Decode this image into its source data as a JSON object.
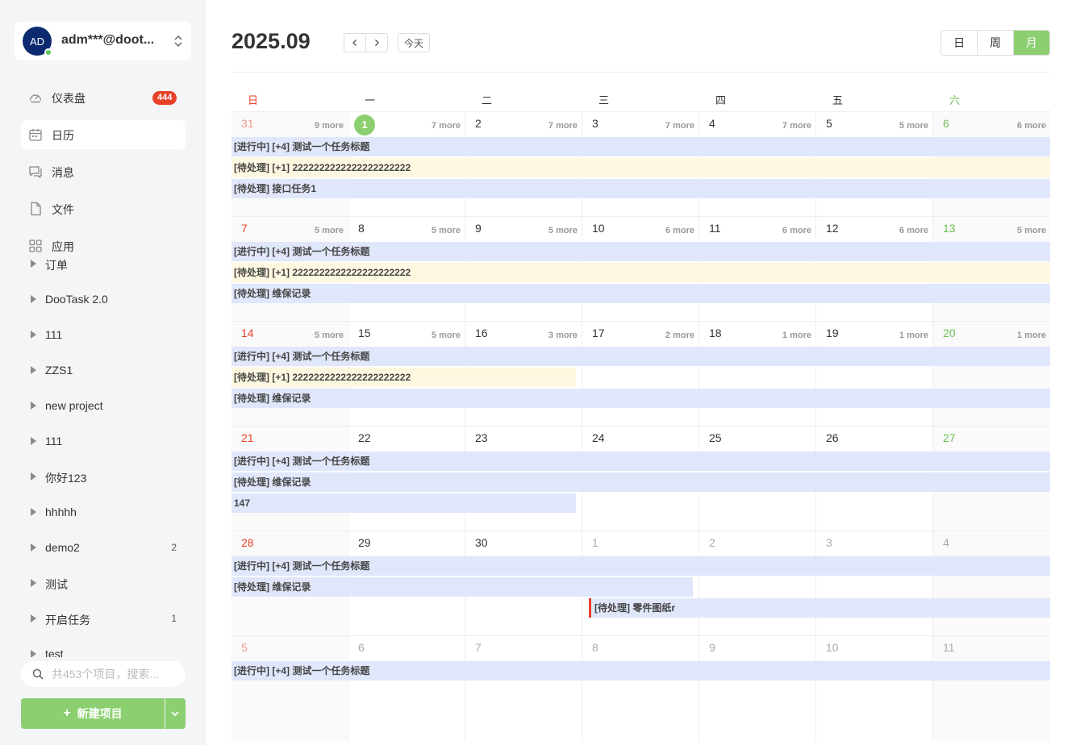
{
  "account": {
    "avatar_text": "AD",
    "name": "adm***@doot..."
  },
  "nav": [
    {
      "label": "仪表盘",
      "icon": "dashboard-icon",
      "badge": "444",
      "active": false
    },
    {
      "label": "日历",
      "icon": "calendar-icon",
      "badge": "",
      "active": true
    },
    {
      "label": "消息",
      "icon": "message-icon",
      "badge": "",
      "active": false
    },
    {
      "label": "文件",
      "icon": "file-icon",
      "badge": "",
      "active": false
    },
    {
      "label": "应用",
      "icon": "apps-icon",
      "badge": "",
      "active": false
    }
  ],
  "projects": [
    {
      "name": "订单",
      "count": ""
    },
    {
      "name": "DooTask 2.0",
      "count": ""
    },
    {
      "name": "111",
      "count": ""
    },
    {
      "name": "ZZS1",
      "count": ""
    },
    {
      "name": "new project",
      "count": ""
    },
    {
      "name": "111",
      "count": ""
    },
    {
      "name": "你好123",
      "count": ""
    },
    {
      "name": "hhhhh",
      "count": ""
    },
    {
      "name": "demo2",
      "count": "2"
    },
    {
      "name": "测试",
      "count": ""
    },
    {
      "name": "开启任务",
      "count": "1"
    },
    {
      "name": "test",
      "count": ""
    }
  ],
  "search": {
    "placeholder": "共453个项目，搜索..."
  },
  "new_project_label": "新建项目",
  "calendar": {
    "title": "2025.09",
    "today_label": "今天",
    "views": [
      {
        "label": "日",
        "active": false
      },
      {
        "label": "周",
        "active": false
      },
      {
        "label": "月",
        "active": true
      }
    ],
    "weekdays": [
      "日",
      "一",
      "二",
      "三",
      "四",
      "五",
      "六"
    ],
    "weeks": [
      {
        "days": [
          {
            "num": "31",
            "other": true,
            "more": "9 more"
          },
          {
            "num": "1",
            "other": false,
            "today": true,
            "more": "7 more"
          },
          {
            "num": "2",
            "other": false,
            "more": "7 more"
          },
          {
            "num": "3",
            "other": false,
            "more": "7 more"
          },
          {
            "num": "4",
            "other": false,
            "more": "7 more"
          },
          {
            "num": "5",
            "other": false,
            "more": "5 more"
          },
          {
            "num": "6",
            "other": false,
            "more": "6 more"
          }
        ],
        "events": [
          {
            "text": "[进行中] [+4] 测试一个任务标题",
            "row": 0,
            "start": 0,
            "end": 7,
            "color": "blue"
          },
          {
            "text": "[待处理] [+1] 2222222222222222222222",
            "row": 1,
            "start": 0,
            "end": 7,
            "color": "yellow"
          },
          {
            "text": "[待处理] 接口任务1",
            "row": 2,
            "start": 0,
            "end": 7,
            "color": "blue"
          }
        ]
      },
      {
        "days": [
          {
            "num": "7",
            "other": false,
            "more": "5 more"
          },
          {
            "num": "8",
            "other": false,
            "more": "5 more"
          },
          {
            "num": "9",
            "other": false,
            "more": "5 more"
          },
          {
            "num": "10",
            "other": false,
            "more": "6 more"
          },
          {
            "num": "11",
            "other": false,
            "more": "6 more"
          },
          {
            "num": "12",
            "other": false,
            "more": "6 more"
          },
          {
            "num": "13",
            "other": false,
            "more": "5 more"
          }
        ],
        "events": [
          {
            "text": "[进行中] [+4] 测试一个任务标题",
            "row": 0,
            "start": 0,
            "end": 7,
            "color": "blue"
          },
          {
            "text": "[待处理] [+1] 2222222222222222222222",
            "row": 1,
            "start": 0,
            "end": 7,
            "color": "yellow"
          },
          {
            "text": "[待处理] 维保记录",
            "row": 2,
            "start": 0,
            "end": 7,
            "color": "blue"
          }
        ]
      },
      {
        "days": [
          {
            "num": "14",
            "other": false,
            "more": "5 more"
          },
          {
            "num": "15",
            "other": false,
            "more": "5 more"
          },
          {
            "num": "16",
            "other": false,
            "more": "3 more"
          },
          {
            "num": "17",
            "other": false,
            "more": "2 more"
          },
          {
            "num": "18",
            "other": false,
            "more": "1 more"
          },
          {
            "num": "19",
            "other": false,
            "more": "1 more"
          },
          {
            "num": "20",
            "other": false,
            "more": "1 more"
          }
        ],
        "events": [
          {
            "text": "[进行中] [+4] 测试一个任务标题",
            "row": 0,
            "start": 0,
            "end": 7,
            "color": "blue"
          },
          {
            "text": "[待处理] [+1] 2222222222222222222222",
            "row": 1,
            "start": 0,
            "end": 3,
            "color": "yellow"
          },
          {
            "text": "[待处理] 维保记录",
            "row": 2,
            "start": 0,
            "end": 7,
            "color": "blue"
          }
        ]
      },
      {
        "days": [
          {
            "num": "21",
            "other": false,
            "more": ""
          },
          {
            "num": "22",
            "other": false,
            "more": ""
          },
          {
            "num": "23",
            "other": false,
            "more": ""
          },
          {
            "num": "24",
            "other": false,
            "more": ""
          },
          {
            "num": "25",
            "other": false,
            "more": ""
          },
          {
            "num": "26",
            "other": false,
            "more": ""
          },
          {
            "num": "27",
            "other": false,
            "more": ""
          }
        ],
        "events": [
          {
            "text": "[进行中] [+4] 测试一个任务标题",
            "row": 0,
            "start": 0,
            "end": 7,
            "color": "blue"
          },
          {
            "text": "[待处理] 维保记录",
            "row": 1,
            "start": 0,
            "end": 7,
            "color": "blue"
          },
          {
            "text": "147",
            "row": 2,
            "start": 0,
            "end": 3,
            "color": "blue"
          }
        ]
      },
      {
        "days": [
          {
            "num": "28",
            "other": false,
            "more": ""
          },
          {
            "num": "29",
            "other": false,
            "more": ""
          },
          {
            "num": "30",
            "other": false,
            "more": ""
          },
          {
            "num": "1",
            "other": true,
            "more": ""
          },
          {
            "num": "2",
            "other": true,
            "more": ""
          },
          {
            "num": "3",
            "other": true,
            "more": ""
          },
          {
            "num": "4",
            "other": true,
            "more": ""
          }
        ],
        "events": [
          {
            "text": "[进行中] [+4] 测试一个任务标题",
            "row": 0,
            "start": 0,
            "end": 7,
            "color": "blue"
          },
          {
            "text": "[待处理] 维保记录",
            "row": 1,
            "start": 0,
            "end": 4,
            "color": "blue"
          },
          {
            "text": "[待处理] 零件图纸r",
            "row": 2,
            "start": 3,
            "end": 7,
            "color": "blue",
            "flag": true
          }
        ]
      },
      {
        "days": [
          {
            "num": "5",
            "other": true,
            "more": ""
          },
          {
            "num": "6",
            "other": true,
            "more": ""
          },
          {
            "num": "7",
            "other": true,
            "more": ""
          },
          {
            "num": "8",
            "other": true,
            "more": ""
          },
          {
            "num": "9",
            "other": true,
            "more": ""
          },
          {
            "num": "10",
            "other": true,
            "more": ""
          },
          {
            "num": "11",
            "other": true,
            "more": ""
          }
        ],
        "events": [
          {
            "text": "[进行中] [+4] 测试一个任务标题",
            "row": 0,
            "start": 0,
            "end": 7,
            "color": "blue"
          }
        ]
      }
    ]
  },
  "colors": {
    "accent": "#8bcf70",
    "badge": "#e8412a",
    "event_blue": "#e1e7fb",
    "event_yellow": "#fef8e1"
  }
}
